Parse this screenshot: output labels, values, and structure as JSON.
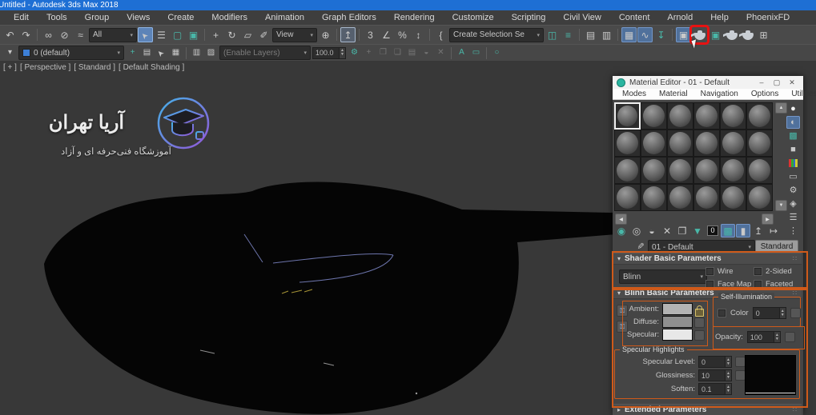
{
  "window": {
    "title": "Untitled - Autodesk 3ds Max 2018"
  },
  "menu_bar": [
    "Edit",
    "Tools",
    "Group",
    "Views",
    "Create",
    "Modifiers",
    "Animation",
    "Graph Editors",
    "Rendering",
    "Customize",
    "Scripting",
    "Civil View",
    "Content",
    "Arnold",
    "Help",
    "PhoenixFD"
  ],
  "toolbar": {
    "filter_value": "All",
    "view_value": "View",
    "selection_set_placeholder": "Create Selection Se",
    "icons_a": [
      {
        "name": "undo-icon",
        "glyph": "↶"
      },
      {
        "name": "redo-icon",
        "glyph": "↷"
      },
      {
        "sep": true
      },
      {
        "name": "select-and-link-icon",
        "glyph": "∞"
      },
      {
        "name": "unlink-selection-icon",
        "glyph": "⊘"
      },
      {
        "name": "bind-to-space-warp-icon",
        "glyph": "≈"
      }
    ],
    "icons_b": [
      {
        "name": "select-object-icon",
        "glyph": "➤",
        "cls": "rot-ul",
        "state": "hl"
      },
      {
        "name": "select-by-name-icon",
        "glyph": "☰"
      },
      {
        "name": "rectangular-selection-region-icon",
        "glyph": "▢",
        "cls": "teal"
      },
      {
        "name": "window-crossing-icon",
        "glyph": "▣",
        "cls": "teal"
      },
      {
        "sep": true
      },
      {
        "name": "select-and-move-icon",
        "glyph": "+"
      },
      {
        "name": "select-and-rotate-icon",
        "glyph": "↻"
      },
      {
        "name": "select-and-scale-icon",
        "glyph": "▱"
      },
      {
        "name": "select-and-place-icon",
        "glyph": "✐"
      }
    ],
    "icons_c": [
      {
        "name": "use-pivot-point-center-icon",
        "glyph": "⊕"
      },
      {
        "sep": true
      },
      {
        "name": "select-and-manipulate-icon",
        "glyph": "↥",
        "state": "boxed"
      },
      {
        "sep": true
      },
      {
        "name": "snaps-toggle-icon",
        "glyph": "3"
      },
      {
        "name": "angle-snap-toggle-icon",
        "glyph": "∠"
      },
      {
        "name": "percent-snap-toggle-icon",
        "glyph": "%"
      },
      {
        "name": "spinner-snap-toggle-icon",
        "glyph": "↕"
      },
      {
        "sep": true
      },
      {
        "name": "edit-named-selection-sets-icon",
        "glyph": "{"
      }
    ],
    "icons_d": [
      {
        "name": "mirror-icon",
        "glyph": "◫",
        "cls": "teal"
      },
      {
        "name": "align-icon",
        "glyph": "≡",
        "cls": "teal"
      },
      {
        "sep": true
      },
      {
        "name": "layer-manager-icon",
        "glyph": "▤"
      },
      {
        "name": "scene-explorer-icon",
        "glyph": "▥"
      },
      {
        "sep": true
      },
      {
        "name": "toggle-layer-explorer-icon",
        "glyph": "▦",
        "state": "hlb"
      },
      {
        "name": "curve-editor-icon",
        "glyph": "∿",
        "state": "hlb"
      },
      {
        "name": "render-to-texture-icon",
        "glyph": "↧",
        "cls": "teal"
      },
      {
        "sep": true
      },
      {
        "name": "render-setup-icon",
        "glyph": "▣",
        "state": "hlb"
      },
      {
        "name": "material-editor-icon",
        "glyph": "",
        "cls": "teapot",
        "state": "redbox",
        "cursor": true
      },
      {
        "name": "rendered-frame-window-icon",
        "glyph": "▣",
        "cls": "teal"
      },
      {
        "name": "render-production-icon",
        "glyph": "",
        "cls": "teapot"
      },
      {
        "name": "render-in-cloud-icon",
        "glyph": "",
        "cls": "teapot"
      },
      {
        "name": "state-sets-icon",
        "glyph": "⊞"
      }
    ]
  },
  "layer_toolbar": {
    "layer_value": "0 (default)",
    "enable_layers_text": "(Enable Layers)",
    "percent_value": "100.0",
    "icons_left": [
      {
        "name": "layer-list-flyout-icon",
        "glyph": "▾"
      }
    ],
    "icons_mid": [
      {
        "name": "create-new-layer-icon",
        "glyph": "+",
        "cls": "teal"
      },
      {
        "name": "add-selection-to-layer-icon",
        "glyph": "▤"
      },
      {
        "name": "select-objects-in-layer-icon",
        "glyph": "➤",
        "cls": "rot-ul"
      },
      {
        "name": "set-current-layer-icon",
        "glyph": "▦"
      },
      {
        "sep": true
      },
      {
        "name": "hide-layer-icon",
        "glyph": "▥"
      },
      {
        "name": "freeze-layer-icon",
        "glyph": "▨"
      }
    ],
    "icons_right": [
      {
        "name": "layer-properties-icon",
        "glyph": "⚙",
        "cls": "teal"
      },
      {
        "name": "new-state-icon",
        "glyph": "+",
        "state": "dis"
      },
      {
        "name": "copy-state-icon",
        "glyph": "❐",
        "state": "dis"
      },
      {
        "name": "paste-state-icon",
        "glyph": "❏",
        "state": "dis"
      },
      {
        "name": "manage-states-icon",
        "glyph": "▤",
        "state": "dis"
      },
      {
        "name": "add-state-icon",
        "glyph": "◒",
        "state": "dis"
      },
      {
        "name": "delete-state-icon",
        "glyph": "✕",
        "state": "dis"
      },
      {
        "sep": true
      },
      {
        "name": "grid-settings-icon",
        "glyph": "A",
        "cls": "teal"
      },
      {
        "name": "measure-tool-icon",
        "glyph": "▭",
        "cls": "teal"
      },
      {
        "sep": true
      },
      {
        "name": "isolate-selection-icon",
        "glyph": "○",
        "cls": "teal"
      }
    ]
  },
  "viewport": {
    "labels": [
      "[ + ]",
      "[ Perspective ]",
      "[ Standard ]",
      "[ Default Shading ]"
    ],
    "watermark_title": "آریا تهران",
    "watermark_subtitle": "آموزشگاه فنی‌حرفه ای و آزاد"
  },
  "material_editor": {
    "title": "Material Editor - 01 - Default",
    "window_controls": [
      {
        "name": "minimize-button",
        "glyph": "–"
      },
      {
        "name": "maximize-button",
        "glyph": "▢"
      },
      {
        "name": "close-button",
        "glyph": "✕"
      }
    ],
    "menus": [
      "Modes",
      "Material",
      "Navigation",
      "Options",
      "Utilities"
    ],
    "sample_slots": {
      "rows": 4,
      "cols": 6,
      "selected": 0
    },
    "side_icons": [
      {
        "name": "sample-type-sphere-icon",
        "glyph": "●",
        "cls": "white"
      },
      {
        "name": "backlight-icon",
        "glyph": "◐",
        "state": "hlb"
      },
      {
        "name": "background-icon",
        "glyph": "▩",
        "cls": "teal"
      },
      {
        "name": "sample-uv-tiling-icon",
        "glyph": "■"
      },
      {
        "name": "video-color-check-icon",
        "glyph": "",
        "cls": "colorbars"
      },
      {
        "name": "make-preview-icon",
        "glyph": "▭"
      },
      {
        "name": "material-editor-options-icon",
        "glyph": "⚙"
      },
      {
        "name": "select-by-material-icon",
        "glyph": "◈"
      },
      {
        "name": "material-map-navigator-icon",
        "glyph": "☰"
      },
      {
        "name": "sample-slot-layout-icon",
        "glyph": "⋮"
      }
    ],
    "tool_icons": [
      {
        "name": "get-material-icon",
        "glyph": "◉",
        "cls": "teal"
      },
      {
        "name": "put-material-to-scene-icon",
        "glyph": "◎"
      },
      {
        "name": "assign-material-to-selection-icon",
        "glyph": "◒"
      },
      {
        "name": "reset-map-icon",
        "glyph": "✕"
      },
      {
        "name": "make-material-copy-icon",
        "glyph": "❐"
      },
      {
        "name": "put-to-library-icon",
        "glyph": "▼",
        "cls": "teal"
      },
      {
        "name": "material-id-channel-icon",
        "glyph": "0",
        "cls": "mtlid"
      },
      {
        "name": "show-map-in-viewport-icon",
        "glyph": "▩",
        "cls": "teal",
        "state": "hlb"
      },
      {
        "name": "show-end-result-icon",
        "glyph": "▮",
        "state": "hlb"
      },
      {
        "name": "go-to-parent-icon",
        "glyph": "↥"
      },
      {
        "name": "go-forward-to-sibling-icon",
        "glyph": "↦"
      }
    ],
    "material_name": "01 - Default",
    "type_button": "Standard",
    "shader_rollout": {
      "title": "Shader Basic Parameters",
      "shader_value": "Blinn",
      "checkboxes": [
        "Wire",
        "2-Sided",
        "Face Map",
        "Faceted"
      ]
    },
    "blinn_rollout": {
      "title": "Blinn Basic Parameters",
      "ambient_label": "Ambient:",
      "diffuse_label": "Diffuse:",
      "specular_label": "Specular:",
      "self_illumination": {
        "title": "Self-Illumination",
        "color_label": "Color",
        "value": "0"
      },
      "opacity_label": "Opacity:",
      "opacity_value": "100",
      "specular_highlights": {
        "title": "Specular Highlights",
        "rows": [
          {
            "label": "Specular Level:",
            "value": "0",
            "map": true
          },
          {
            "label": "Glossiness:",
            "value": "10",
            "map": true
          },
          {
            "label": "Soften:",
            "value": "0.1",
            "map": false
          }
        ]
      }
    },
    "extended_rollout": "Extended Parameters",
    "swatches": {
      "ambient": "#b3b3b3",
      "diffuse": "#8f8f8f",
      "specular": "#e8e8e8"
    }
  },
  "ui": {
    "dropdown_arrow": "▾",
    "spinner_up": "▲",
    "spinner_down": "▼",
    "scroll_up": "▲",
    "scroll_down": "▼",
    "scroll_left": "◀",
    "scroll_right": "▶",
    "rollout_open": "▾",
    "rollout_closed": "▸",
    "grip": "∷",
    "eyedropper": "✎"
  },
  "colors": {
    "annotation_orange": "#cf5a1a",
    "highlight_red": "#e81212",
    "titlebar_blue": "#1e6fd4",
    "accent_teal": "#49b7a8"
  }
}
